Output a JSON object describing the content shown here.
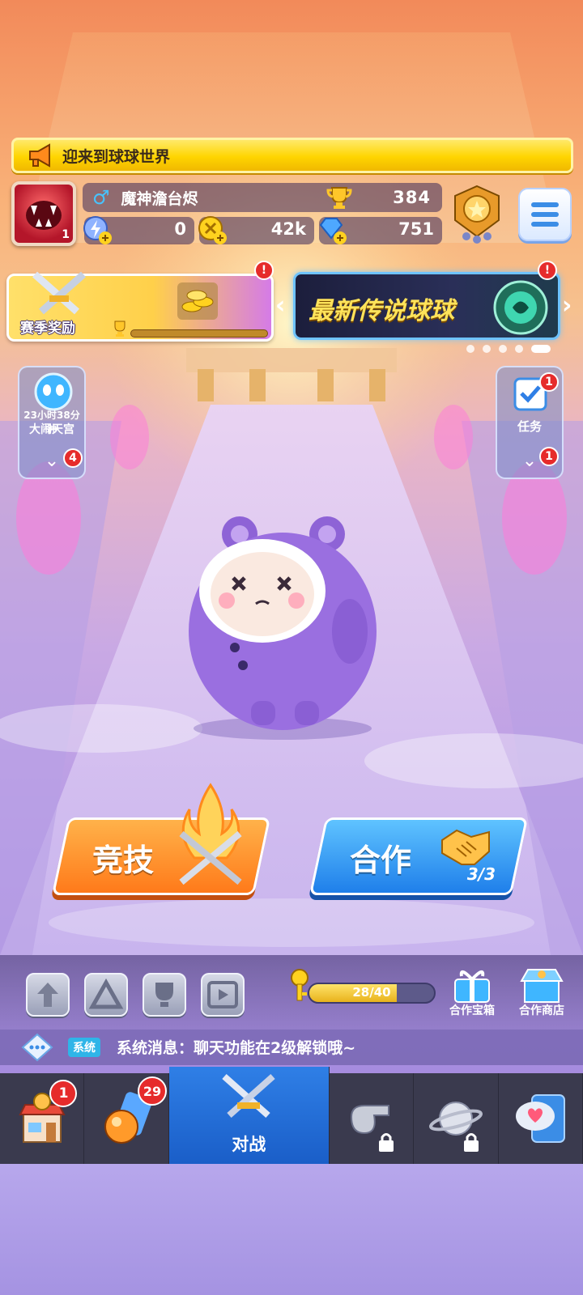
{
  "banner": {
    "text": "迎来到球球世界",
    "icon": "megaphone-icon"
  },
  "player": {
    "level": "1",
    "gender_symbol": "♂",
    "name": "魔神澹台烬",
    "trophies": "384",
    "energy": "0",
    "coins": "42k",
    "diamonds": "751"
  },
  "season": {
    "label": "赛季奖励",
    "progress": 0.0
  },
  "legend_banner": {
    "text": "最新传说球球"
  },
  "left_panel": {
    "timer": "23小时38分钟",
    "title": "大闹天宫",
    "badge": "4"
  },
  "right_panel": {
    "title": "任务",
    "badge_top": "1",
    "badge_bottom": "1"
  },
  "alerts": {
    "season": "!",
    "legend": "!"
  },
  "modes": {
    "arena": {
      "label": "竞技"
    },
    "coop": {
      "label": "合作",
      "count": "3/3"
    }
  },
  "keys": {
    "text": "28/40",
    "value": 28,
    "max": 40
  },
  "shops": {
    "coop_chest": "合作宝箱",
    "coop_shop": "合作商店"
  },
  "chat": {
    "tag": "系统",
    "message": "系统消息：聊天功能在2级解锁哦~"
  },
  "nav": {
    "shop_badge": "1",
    "balls_badge": "29",
    "battle_label": "对战"
  },
  "colors": {
    "banner_yellow": "#ffd500",
    "arena_orange": "#ff7a1a",
    "coop_blue": "#1f7fea",
    "nav_active": "#2f7fe6",
    "alert_red": "#e62b2b"
  }
}
